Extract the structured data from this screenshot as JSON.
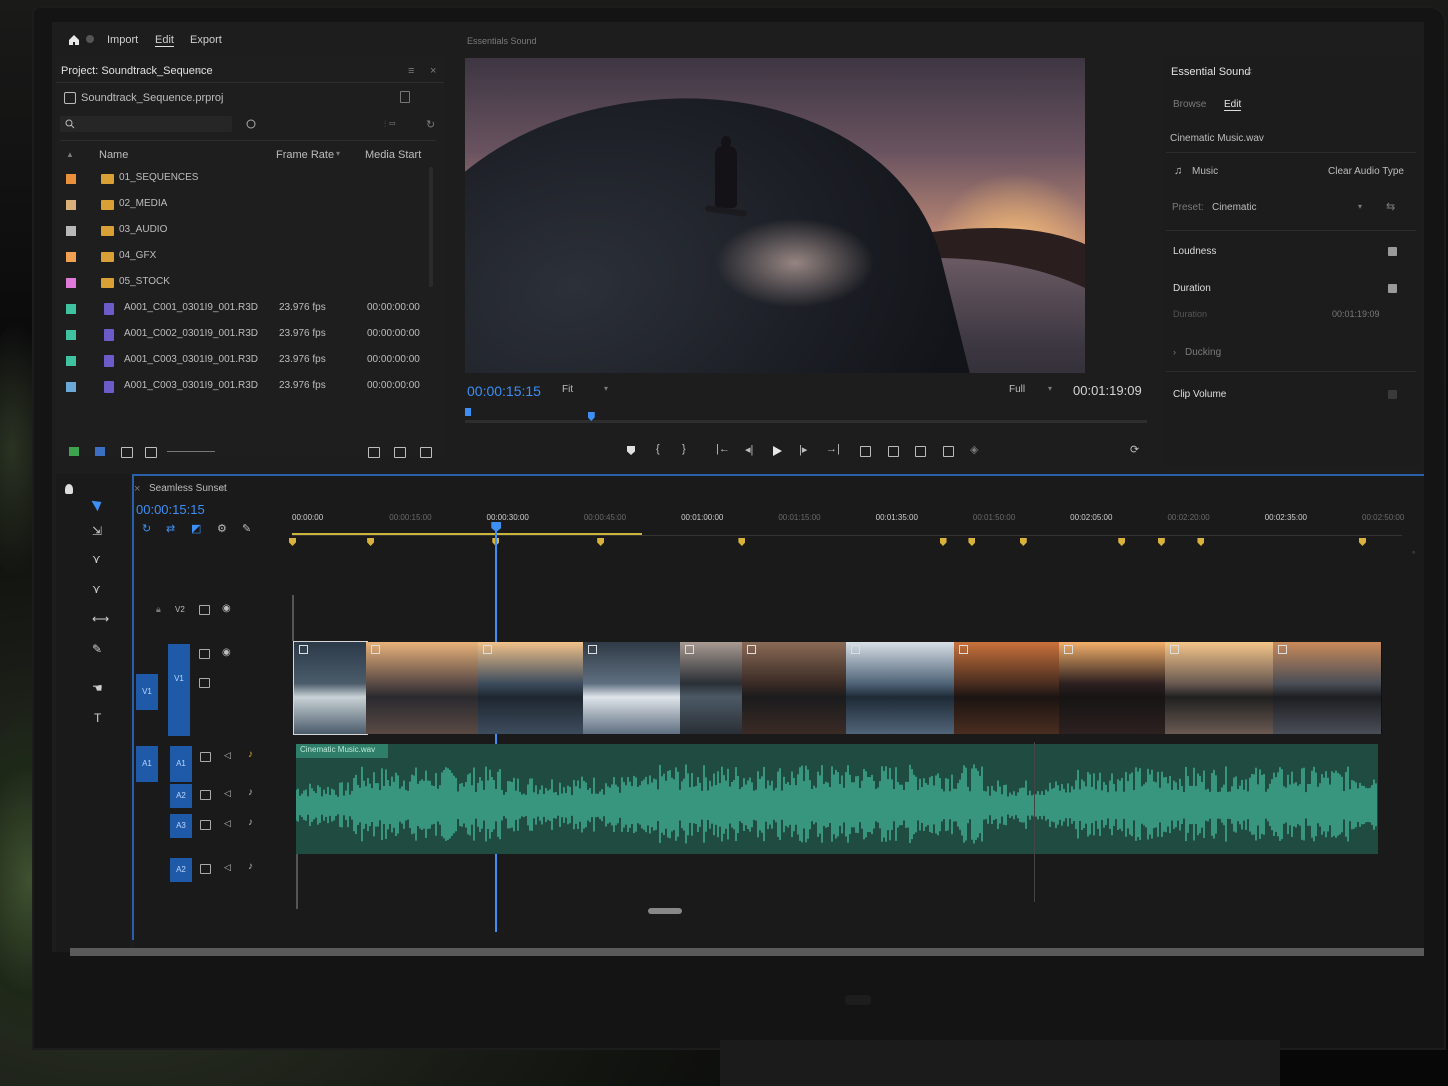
{
  "menu": {
    "import": "Import",
    "edit": "Edit",
    "export": "Export"
  },
  "project": {
    "tab_title": "Project: Soundtrack_Sequence",
    "file_name": "Soundtrack_Sequence.prproj",
    "items_count": "",
    "columns": {
      "name": "Name",
      "frame_rate": "Frame Rate",
      "media_start": "Media Start"
    },
    "rows": [
      {
        "color": "#e8913a",
        "type": "folder",
        "name": "01_SEQUENCES",
        "fps": "",
        "start": ""
      },
      {
        "color": "#d9b07a",
        "type": "folder",
        "name": "02_MEDIA",
        "fps": "",
        "start": ""
      },
      {
        "color": "#b8b8b8",
        "type": "folder",
        "name": "03_AUDIO",
        "fps": "",
        "start": ""
      },
      {
        "color": "#f0a050",
        "type": "folder",
        "name": "04_GFX",
        "fps": "",
        "start": ""
      },
      {
        "color": "#e07ad8",
        "type": "folder",
        "name": "05_STOCK",
        "fps": "",
        "start": ""
      },
      {
        "color": "#3ec2a0",
        "type": "file",
        "name": "A001_C001_0301I9_001.R3D",
        "fps": "23.976 fps",
        "start": "00:00:00:00"
      },
      {
        "color": "#3ec2a0",
        "type": "file",
        "name": "A001_C002_0301I9_001.R3D",
        "fps": "23.976 fps",
        "start": "00:00:00:00"
      },
      {
        "color": "#3ec2a0",
        "type": "file",
        "name": "A001_C003_0301I9_001.R3D",
        "fps": "23.976 fps",
        "start": "00:00:00:00"
      },
      {
        "color": "#6aa8d8",
        "type": "file",
        "name": "A001_C003_0301I9_001.R3D",
        "fps": "23.976 fps",
        "start": "00:00:00:00"
      }
    ]
  },
  "program": {
    "tab_title": "Essentials Sound",
    "current_time": "00:00:15:15",
    "fit": "Fit",
    "quality": "Full",
    "duration": "00:01:19:09",
    "playhead_fraction": 0.18
  },
  "essential_sound": {
    "title": "Essential Sound",
    "tabs": [
      "Browse",
      "Edit"
    ],
    "active_tab": "Edit",
    "clip_name": "Cinematic Music.wav",
    "audio_type": "Music",
    "clear_label": "Clear Audio Type",
    "preset_label": "Preset:",
    "preset_value": "Cinematic",
    "loudness": "Loudness",
    "duration_label": "Duration",
    "duration_sub": "Duration",
    "duration_value": "00:01:19:09",
    "ducking": "Ducking",
    "clip_volume": "Clip Volume"
  },
  "timeline": {
    "tab_title": "Seamless Sunset",
    "current_time": "00:00:15:15",
    "ruler": [
      "00:00:00",
      "00:00:15:00",
      "00:00:30:00",
      "00:00:45:00",
      "00:01:00:00",
      "00:01:15:00",
      "00:01:35:00",
      "00:01:50:00",
      "00:02:05:00",
      "00:02:20:00",
      "00:02:35:00",
      "00:02:50:00"
    ],
    "tracks_video": [
      "V2",
      "V1"
    ],
    "tracks_audio": [
      "A1",
      "A2",
      "A3",
      "A2"
    ],
    "source_patch": {
      "video": "V1",
      "audio": "A1"
    },
    "audio_clip": "Cinematic Music.wav",
    "playhead_fraction": 0.19,
    "marker_fractions": [
      0.0,
      0.073,
      0.19,
      0.288,
      0.42,
      0.608,
      0.635,
      0.683,
      0.775,
      0.812,
      0.849,
      1.0
    ]
  },
  "colors": {
    "accent": "#3d8ff5",
    "audio": "#3fa88e",
    "marker": "#d8b23a",
    "track_label": "#1e5aa8"
  },
  "icons": [
    "home-icon",
    "search-icon",
    "play-icon",
    "step-back-icon",
    "step-forward-icon",
    "marker-icon",
    "camera-icon",
    "wrench-icon",
    "music-icon"
  ]
}
